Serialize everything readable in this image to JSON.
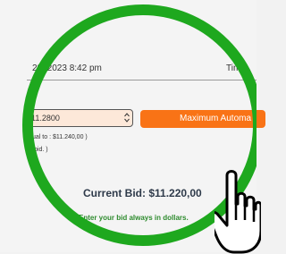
{
  "auction": {
    "date_text": "29, 2023 8:42 pm",
    "time_label": "Tim"
  },
  "bid": {
    "select_value": "11.2800",
    "automatic_button_label": "Maximum Automa",
    "note_equal": "ual to : $11.240,00 )",
    "note_bid": "bid. )",
    "current_bid": "Current Bid: $11.220,00",
    "hint": "Enter your bid always in dollars."
  },
  "colors": {
    "highlight_ring": "#1ea81e",
    "button_orange": "#f97316",
    "hint_green": "#2e8b2e",
    "select_bg": "#fde8d9"
  },
  "icons": {
    "select_arrow": "up-down-arrows-icon",
    "cursor": "hand-pointer-icon"
  }
}
